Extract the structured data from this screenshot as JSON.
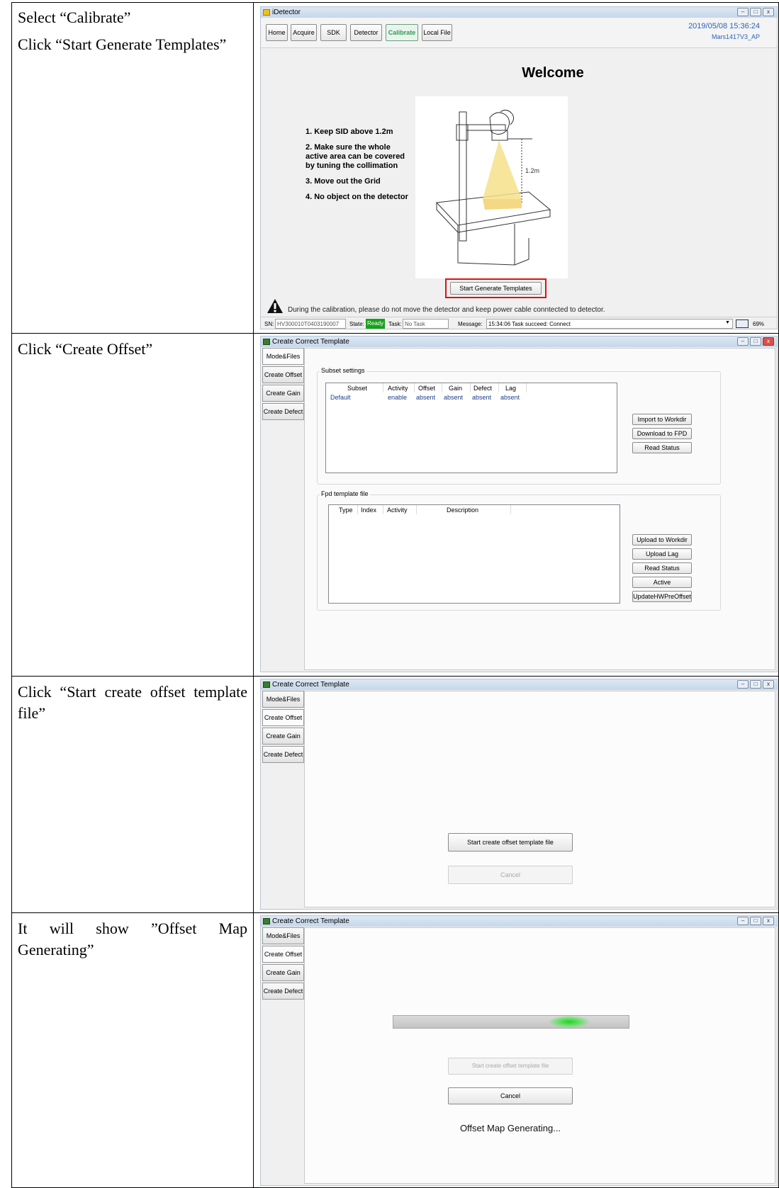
{
  "rows": [
    {
      "instructions": [
        "Select “Calibrate”",
        "Click “Start Generate Templates”"
      ]
    },
    {
      "instructions": [
        "Click “Create Offset”"
      ]
    },
    {
      "instructions": [
        "Click “Start create offset template file”"
      ]
    },
    {
      "instructions": [
        "It will show ”Offset Map Generating”"
      ]
    }
  ],
  "idetector": {
    "window_title": "iDetector",
    "tabs": [
      "Home",
      "Acquire",
      "SDK",
      "Detector",
      "Calibrate",
      "Local File"
    ],
    "active_tab": "Calibrate",
    "datetime": "2019/05/08 15:36:24",
    "model": "Mars1417V3_AP",
    "heading": "Welcome",
    "steps": [
      "1. Keep SID above 1.2m",
      "2. Make sure the whole active area can be covered by tuning the collimation",
      "3. Move out the Grid",
      "4. No object on the detector"
    ],
    "illustration_label": "1.2m",
    "start_button": "Start Generate Templates",
    "warning": "During the calibration, please do not move the detector and keep power cable conntected to detector.",
    "status": {
      "sn_label": "SN:",
      "sn_value": "HV300010T0403190007",
      "state_label": "State:",
      "state_value": "Ready",
      "task_label": "Task:",
      "task_value": "No Task",
      "message_label": "Message:",
      "message_value": "15:34:06 Task succeed: Connect",
      "zoom": "69%"
    }
  },
  "cct": {
    "window_title": "Create Correct Template",
    "side_tabs": [
      "Mode&Files",
      "Create Offset",
      "Create Gain",
      "Create Defect"
    ],
    "subset": {
      "group_label": "Subset settings",
      "columns": [
        "Subset",
        "Activity",
        "Offset",
        "Gain",
        "Defect",
        "Lag"
      ],
      "rows": [
        [
          "Default",
          "enable",
          "absent",
          "absent",
          "absent",
          "absent"
        ]
      ],
      "buttons": [
        "Import to Workdir",
        "Download to FPD",
        "Read Status"
      ]
    },
    "fpd": {
      "group_label": "Fpd template file",
      "columns": [
        "Type",
        "Index",
        "Activity",
        "Description"
      ],
      "buttons": [
        "Upload to Workdir",
        "Upload Lag",
        "Read Status",
        "Active",
        "UpdateHWPreOffset"
      ]
    },
    "offset": {
      "start_button": "Start create offset template file",
      "cancel_button": "Cancel",
      "generating_text": "Offset Map Generating...",
      "progress_indeterminate": true
    }
  },
  "colors": {
    "calibrate_tab": "#2f9a5c",
    "ready_state": "#1aa01a",
    "highlight_box": "#e01010",
    "datetime": "#2a64b8"
  }
}
